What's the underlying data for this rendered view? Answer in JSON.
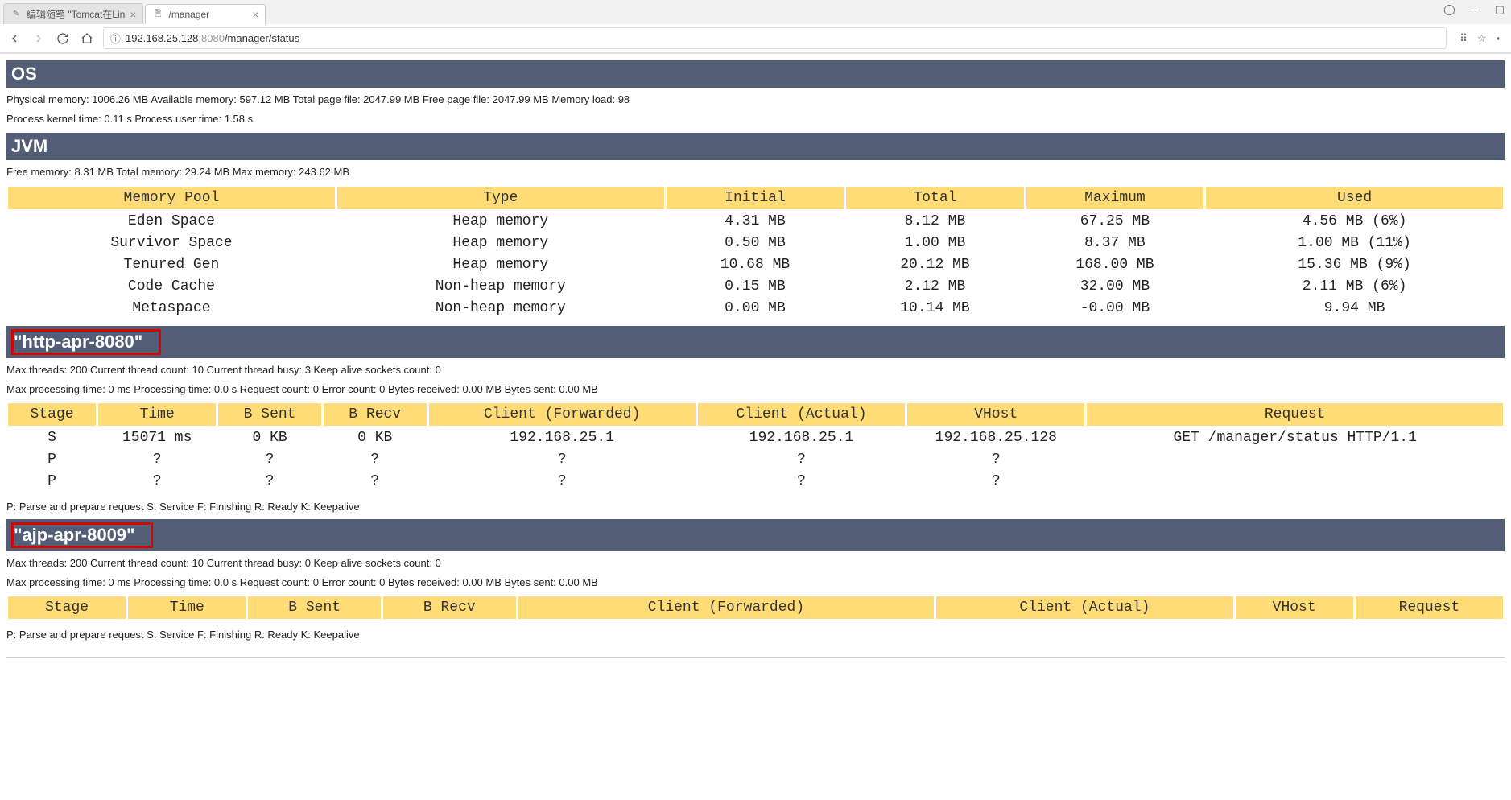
{
  "browser": {
    "tabs": [
      {
        "title": "编辑随笔 \"Tomcat在Lin",
        "active": false
      },
      {
        "title": "/manager",
        "active": true
      }
    ],
    "url_host": "192.168.25.128",
    "url_port": ":8080",
    "url_path": "/manager/status",
    "win_controls": {
      "user": "◯",
      "min": "—",
      "max": "▢"
    }
  },
  "sections": {
    "os": {
      "title": "OS",
      "line1": "Physical memory: 1006.26 MB Available memory: 597.12 MB Total page file: 2047.99 MB Free page file: 2047.99 MB Memory load: 98",
      "line2": "Process kernel time: 0.11 s Process user time: 1.58 s"
    },
    "jvm": {
      "title": "JVM",
      "line1": "Free memory: 8.31 MB Total memory: 29.24 MB Max memory: 243.62 MB",
      "headers": [
        "Memory Pool",
        "Type",
        "Initial",
        "Total",
        "Maximum",
        "Used"
      ],
      "rows": [
        [
          "Eden Space",
          "Heap memory",
          "4.31 MB",
          "8.12 MB",
          "67.25 MB",
          "4.56 MB (6%)"
        ],
        [
          "Survivor Space",
          "Heap memory",
          "0.50 MB",
          "1.00 MB",
          "8.37 MB",
          "1.00 MB (11%)"
        ],
        [
          "Tenured Gen",
          "Heap memory",
          "10.68 MB",
          "20.12 MB",
          "168.00 MB",
          "15.36 MB (9%)"
        ],
        [
          "Code Cache",
          "Non-heap memory",
          "0.15 MB",
          "2.12 MB",
          "32.00 MB",
          "2.11 MB (6%)"
        ],
        [
          "Metaspace",
          "Non-heap memory",
          "0.00 MB",
          "10.14 MB",
          "-0.00 MB",
          "9.94 MB"
        ]
      ]
    },
    "http": {
      "title": "\"http-apr-8080\"",
      "line1": "Max threads: 200 Current thread count: 10 Current thread busy: 3 Keep alive sockets count: 0",
      "line2": "Max processing time: 0 ms Processing time: 0.0 s Request count: 0 Error count: 0 Bytes received: 0.00 MB Bytes sent: 0.00 MB",
      "headers": [
        "Stage",
        "Time",
        "B Sent",
        "B Recv",
        "Client (Forwarded)",
        "Client (Actual)",
        "VHost",
        "Request"
      ],
      "rows": [
        [
          "S",
          "15071 ms",
          "0 KB",
          "0 KB",
          "192.168.25.1",
          "192.168.25.1",
          "192.168.25.128",
          "GET /manager/status HTTP/1.1"
        ],
        [
          "P",
          "?",
          "?",
          "?",
          "?",
          "?",
          "?",
          ""
        ],
        [
          "P",
          "?",
          "?",
          "?",
          "?",
          "?",
          "?",
          ""
        ]
      ],
      "legend": "P: Parse and prepare request S: Service F: Finishing R: Ready K: Keepalive"
    },
    "ajp": {
      "title": "\"ajp-apr-8009\"",
      "line1": "Max threads: 200 Current thread count: 10 Current thread busy: 0 Keep alive sockets count: 0",
      "line2": "Max processing time: 0 ms Processing time: 0.0 s Request count: 0 Error count: 0 Bytes received: 0.00 MB Bytes sent: 0.00 MB",
      "headers": [
        "Stage",
        "Time",
        "B Sent",
        "B Recv",
        "Client (Forwarded)",
        "Client (Actual)",
        "VHost",
        "Request"
      ],
      "legend": "P: Parse and prepare request S: Service F: Finishing R: Ready K: Keepalive"
    }
  }
}
